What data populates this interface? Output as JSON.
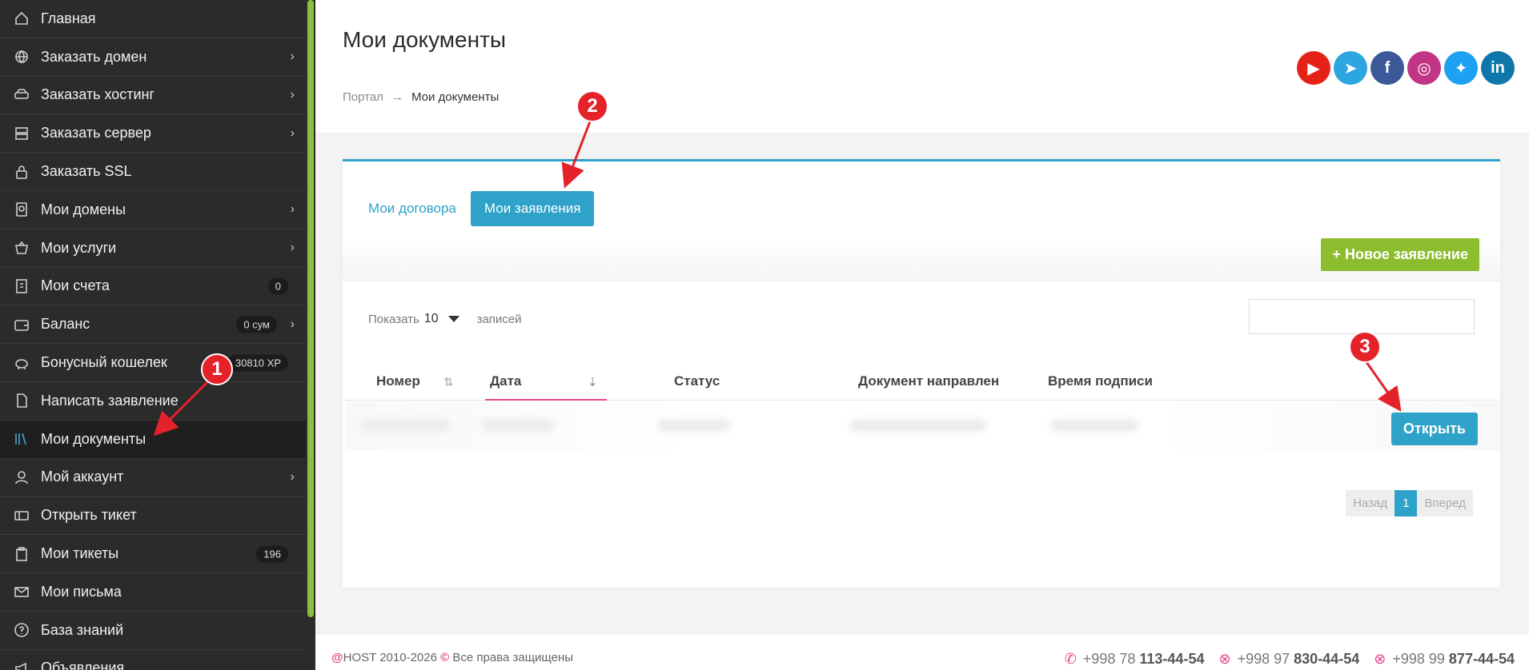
{
  "sidebar": {
    "items": [
      {
        "label": "Главная",
        "icon": "home-icon"
      },
      {
        "label": "Заказать домен",
        "icon": "globe-icon",
        "chevron": true
      },
      {
        "label": "Заказать хостинг",
        "icon": "hdd-icon",
        "chevron": true
      },
      {
        "label": "Заказать сервер",
        "icon": "server-icon",
        "chevron": true
      },
      {
        "label": "Заказать SSL",
        "icon": "lock-icon"
      },
      {
        "label": "Мои домены",
        "icon": "passport-icon",
        "chevron": true
      },
      {
        "label": "Мои услуги",
        "icon": "basket-icon",
        "chevron": true
      },
      {
        "label": "Мои счета",
        "icon": "invoice-icon",
        "badge": "0"
      },
      {
        "label": "Баланс",
        "icon": "wallet-icon",
        "badge": "0 сум",
        "chevron": true
      },
      {
        "label": "Бонусный кошелек",
        "icon": "piggybank-icon",
        "badge": "30810 XP"
      },
      {
        "label": "Написать заявление",
        "icon": "file-icon"
      },
      {
        "label": "Мои документы",
        "icon": "books-icon",
        "active": true
      },
      {
        "label": "Мой аккаунт",
        "icon": "user-icon",
        "chevron": true
      },
      {
        "label": "Открыть тикет",
        "icon": "ticket-icon"
      },
      {
        "label": "Мои тикеты",
        "icon": "clipboard-icon",
        "badge": "196"
      },
      {
        "label": "Мои письма",
        "icon": "mail-icon"
      },
      {
        "label": "База знаний",
        "icon": "question-icon"
      },
      {
        "label": "Объявления",
        "icon": "megaphone-icon"
      }
    ]
  },
  "header": {
    "title": "Мои документы",
    "breadcrumb": {
      "portal": "Портал",
      "sep": "→",
      "current": "Мои документы"
    }
  },
  "social": [
    {
      "name": "youtube-icon",
      "glyph": "▶",
      "color": "#e62117"
    },
    {
      "name": "telegram-icon",
      "glyph": "➤",
      "color": "#2ca5e0"
    },
    {
      "name": "facebook-icon",
      "glyph": "f",
      "color": "#3b5998"
    },
    {
      "name": "instagram-icon",
      "glyph": "◎",
      "color": "#c13584"
    },
    {
      "name": "twitter-icon",
      "glyph": "✦",
      "color": "#1da1f2"
    },
    {
      "name": "linkedin-icon",
      "glyph": "in",
      "color": "#0e76a8"
    }
  ],
  "tabs": {
    "contracts": "Мои договора",
    "applications": "Мои заявления"
  },
  "new_button": "Новое заявление",
  "table": {
    "show": "Показать",
    "length": "10",
    "records": "записей",
    "columns": [
      "Номер",
      "Дата",
      "Статус",
      "Документ направлен",
      "Время подписи"
    ],
    "open_button": "Открыть"
  },
  "pager": {
    "prev": "Назад",
    "page": "1",
    "next": "Вперед"
  },
  "footer": {
    "brand": "@",
    "copy": "HOST 2010-2026",
    "c": "©",
    "rights": "Все права защищены",
    "phones": [
      {
        "prefix": "+998 78",
        "number": "113-44-54"
      },
      {
        "prefix": "+998 97",
        "number": "830-44-54"
      },
      {
        "prefix": "+998 99",
        "number": "877-44-54"
      }
    ]
  },
  "annotations": [
    "1",
    "2",
    "3"
  ]
}
